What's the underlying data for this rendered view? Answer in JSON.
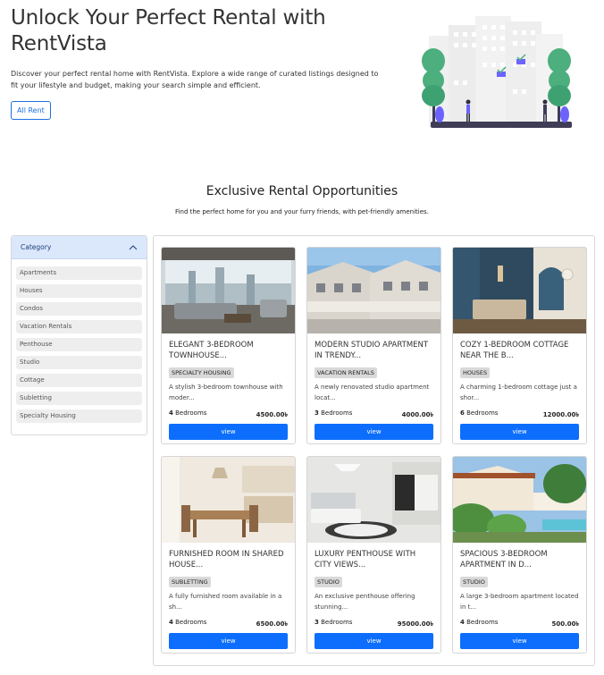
{
  "hero": {
    "title": "Unlock Your Perfect Rental with RentVista",
    "description": "Discover your perfect rental home with RentVista. Explore a wide range of curated listings designed to fit your lifestyle and budget, making your search simple and efficient.",
    "button_label": "All Rent"
  },
  "section": {
    "title": "Exclusive Rental Opportunities",
    "subtitle": "Find the perfect home for you and your furry friends, with pet-friendly amenities."
  },
  "sidebar": {
    "heading": "Category",
    "items": [
      "Apartments",
      "Houses",
      "Condos",
      "Vacation Rentals",
      "Penthouse",
      "Studio",
      "Cottage",
      "Subletting",
      "Specialty Housing"
    ]
  },
  "listings": [
    {
      "title": "ELEGANT 3-BEDROOM TOWNHOUSE...",
      "badge": "SPECIALTY HOUSING",
      "desc": "A stylish 3-bedroom townhouse with moder...",
      "bedrooms": "4",
      "bedrooms_label": "Bedrooms",
      "price": "4500.00৳",
      "view_label": "view"
    },
    {
      "title": "MODERN STUDIO APARTMENT IN TRENDY...",
      "badge": "VACATION RENTALS",
      "desc": "A newly renovated studio apartment locat...",
      "bedrooms": "3",
      "bedrooms_label": "Bedrooms",
      "price": "4000.00৳",
      "view_label": "view"
    },
    {
      "title": "COZY 1-BEDROOM COTTAGE NEAR THE B...",
      "badge": "HOUSES",
      "desc": "A charming 1-bedroom cottage just a shor...",
      "bedrooms": "6",
      "bedrooms_label": "Bedrooms",
      "price": "12000.00৳",
      "view_label": "view"
    },
    {
      "title": "FURNISHED ROOM IN SHARED HOUSE...",
      "badge": "SUBLETTING",
      "desc": "A fully furnished room available in a sh...",
      "bedrooms": "4",
      "bedrooms_label": "Bedrooms",
      "price": "6500.00৳",
      "view_label": "view"
    },
    {
      "title": "LUXURY PENTHOUSE WITH CITY VIEWS...",
      "badge": "STUDIO",
      "desc": "An exclusive penthouse offering stunning...",
      "bedrooms": "3",
      "bedrooms_label": "Bedrooms",
      "price": "95000.00৳",
      "view_label": "view"
    },
    {
      "title": "SPACIOUS 3-BEDROOM APARTMENT IN D...",
      "badge": "STUDIO",
      "desc": "A large 3-bedroom apartment located in t...",
      "bedrooms": "4",
      "bedrooms_label": "Bedrooms",
      "price": "500.00৳",
      "view_label": "view"
    }
  ],
  "colors": {
    "accent": "#0d6efd",
    "sidebar_header": "#dbe7fb",
    "illustration_green": "#4caf7d",
    "illustration_purple": "#6c63ff"
  }
}
